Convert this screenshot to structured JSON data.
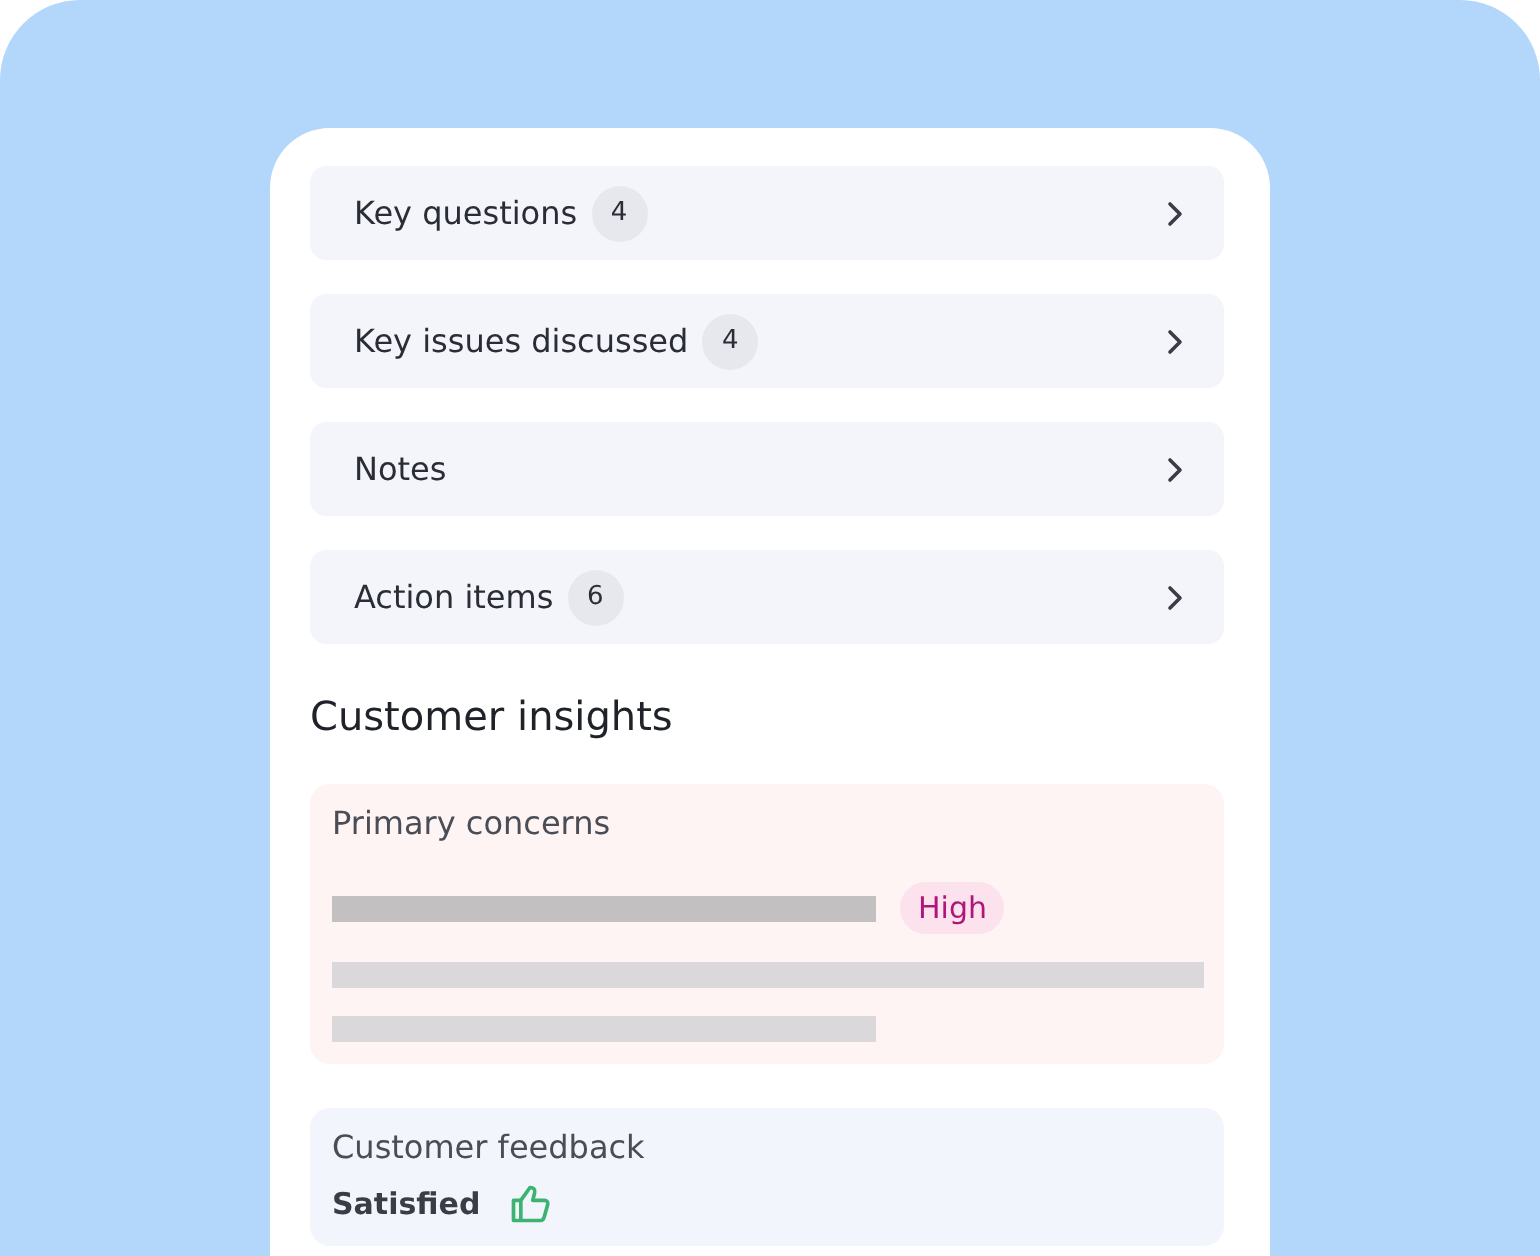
{
  "sections": [
    {
      "label": "Key questions",
      "count": "4"
    },
    {
      "label": "Key issues discussed",
      "count": "4"
    },
    {
      "label": "Notes"
    },
    {
      "label": "Action items",
      "count": "6"
    }
  ],
  "insights": {
    "title": "Customer insights",
    "cards": [
      {
        "kind": "concerns",
        "title": "Primary concerns",
        "badge": "High"
      },
      {
        "kind": "feedback",
        "title": "Customer feedback",
        "sentiment": "Satisfied"
      }
    ]
  }
}
